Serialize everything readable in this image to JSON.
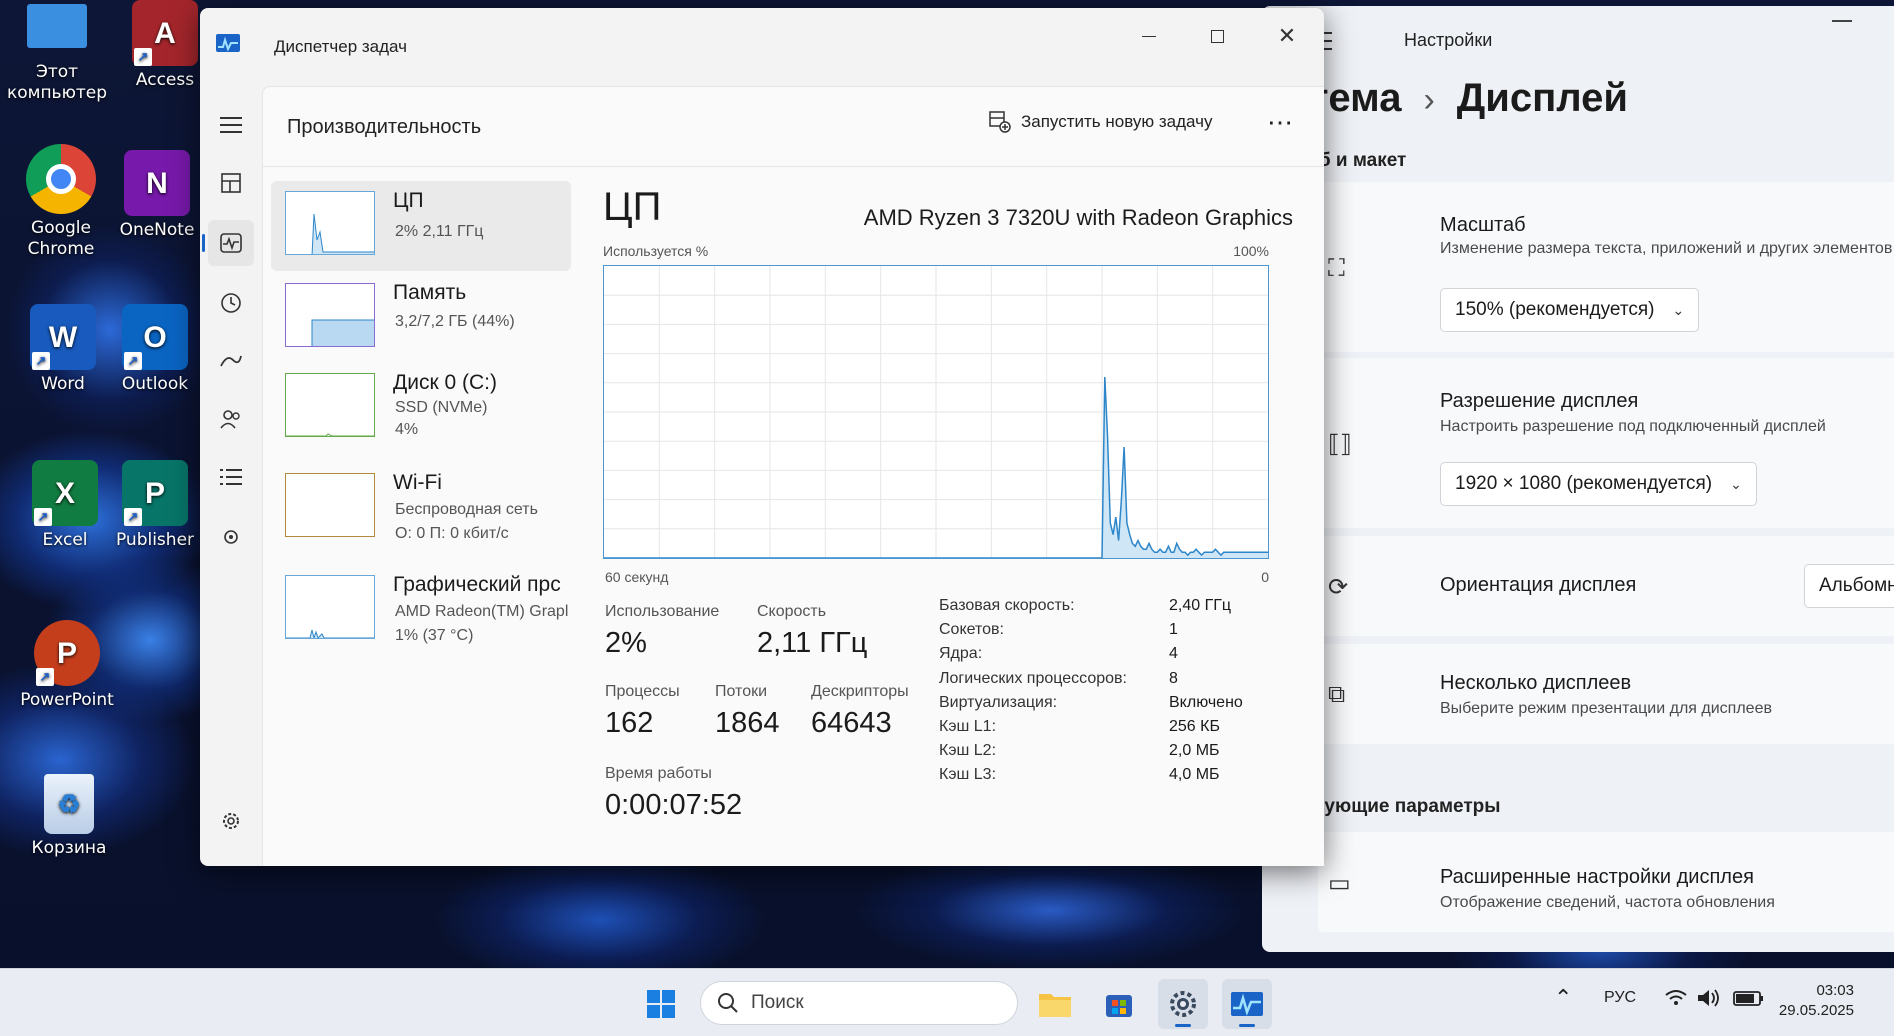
{
  "desktop": {
    "icons": [
      {
        "label_line1": "Этот",
        "label_line2": "компьютер",
        "name": "this-pc"
      },
      {
        "label_line1": "Access",
        "label_line2": "",
        "name": "access"
      },
      {
        "label_line1": "Google",
        "label_line2": "Chrome",
        "name": "chrome"
      },
      {
        "label_line1": "OneNote",
        "label_line2": "",
        "name": "onenote"
      },
      {
        "label_line1": "Word",
        "label_line2": "",
        "name": "word"
      },
      {
        "label_line1": "Outlook",
        "label_line2": "",
        "name": "outlook"
      },
      {
        "label_line1": "Excel",
        "label_line2": "",
        "name": "excel"
      },
      {
        "label_line1": "Publisher",
        "label_line2": "",
        "name": "publisher"
      },
      {
        "label_line1": "PowerPoint",
        "label_line2": "",
        "name": "powerpoint"
      },
      {
        "label_line1": "Корзина",
        "label_line2": "",
        "name": "recycle-bin"
      }
    ],
    "icon_letters": {
      "access": "A",
      "onenote": "N",
      "word": "W",
      "outlook": "O",
      "excel": "X",
      "publisher": "P",
      "powerpoint": "P"
    }
  },
  "task_manager": {
    "title": "Диспетчер задач",
    "page_title": "Производительность",
    "new_task_label": "Запустить новую задачу",
    "more_label": "⋯",
    "nav_icons": [
      "hamburger-icon",
      "processes-icon",
      "performance-icon",
      "app-history-icon",
      "startup-icon",
      "users-icon",
      "details-icon",
      "services-icon",
      "settings-icon"
    ],
    "perf_items": [
      {
        "name": "ЦП",
        "sub1": "2% 2,11 ГГц",
        "sub2": "",
        "sub3": ""
      },
      {
        "name": "Память",
        "sub1": "3,2/7,2 ГБ (44%)",
        "sub2": "",
        "sub3": ""
      },
      {
        "name": "Диск 0 (C:)",
        "sub1": "SSD (NVMe)",
        "sub2": "4%",
        "sub3": ""
      },
      {
        "name": "Wi-Fi",
        "sub1": "Беспроводная сеть",
        "sub2": "О: 0 П: 0 кбит/с",
        "sub3": ""
      },
      {
        "name": "Графический прс",
        "sub1": "AMD Radeon(TM) Grapl",
        "sub2": "1% (37 °C)",
        "sub3": ""
      }
    ],
    "cpu": {
      "heading": "ЦП",
      "model": "AMD Ryzen 3 7320U with Radeon Graphics",
      "graph_label_top_left": "Используется %",
      "graph_label_top_right": "100%",
      "graph_label_bottom_left": "60 секунд",
      "graph_label_bottom_right": "0",
      "usage_label": "Использование",
      "usage_value": "2%",
      "speed_label": "Скорость",
      "speed_value": "2,11 ГГц",
      "processes_label": "Процессы",
      "processes_value": "162",
      "threads_label": "Потоки",
      "threads_value": "1864",
      "handles_label": "Дескрипторы",
      "handles_value": "64643",
      "uptime_label": "Время работы",
      "uptime_value": "0:00:07:52",
      "specs": [
        {
          "k": "Базовая скорость:",
          "v": "2,40 ГГц"
        },
        {
          "k": "Сокетов:",
          "v": "1"
        },
        {
          "k": "Ядра:",
          "v": "4"
        },
        {
          "k": "Логических процессоров:",
          "v": "8"
        },
        {
          "k": "Виртуализация:",
          "v": "Включено"
        },
        {
          "k": "Кэш L1:",
          "v": "256 КБ"
        },
        {
          "k": "Кэш L2:",
          "v": "2,0 МБ"
        },
        {
          "k": "Кэш L3:",
          "v": "4,0 МБ"
        }
      ]
    },
    "cpu_history_percent": [
      0,
      0,
      0,
      0,
      0,
      0,
      0,
      0,
      0,
      0,
      0,
      0,
      0,
      0,
      0,
      0,
      0,
      0,
      0,
      0,
      0,
      0,
      0,
      0,
      0,
      0,
      0,
      0,
      0,
      0,
      0,
      0,
      0,
      0,
      0,
      0,
      0,
      0,
      0,
      0,
      0,
      0,
      0,
      0,
      0,
      0,
      0,
      0,
      0,
      0,
      0,
      0,
      0,
      0,
      0,
      0,
      0,
      0,
      0,
      0,
      0,
      0,
      0,
      0,
      0,
      0,
      0,
      0,
      0,
      0,
      0,
      0,
      0,
      0,
      0,
      0,
      0,
      0,
      0,
      0,
      0,
      0,
      0,
      0,
      0,
      0,
      0,
      0,
      0,
      0,
      0,
      0,
      0,
      0,
      0,
      0,
      0,
      0,
      0,
      0,
      0,
      0,
      0,
      0,
      0,
      0,
      0,
      0,
      0,
      0,
      0,
      0,
      0,
      0,
      0,
      0,
      0,
      0,
      0,
      0,
      0,
      0,
      0,
      0,
      0,
      0,
      0,
      0,
      0,
      0,
      0,
      0,
      0,
      0,
      0,
      0,
      0,
      0,
      0,
      0,
      0,
      0,
      0,
      0,
      0,
      0,
      0,
      0,
      0,
      0,
      0,
      0,
      0,
      0,
      0,
      0,
      0,
      0,
      0,
      0,
      0,
      0,
      0,
      0,
      0,
      0,
      0,
      0,
      0,
      0,
      0,
      0,
      0,
      0,
      0,
      0,
      0,
      0,
      0,
      0,
      0,
      62,
      42,
      12,
      8,
      14,
      6,
      20,
      38,
      12,
      8,
      5,
      4,
      6,
      4,
      3,
      3,
      5,
      3,
      2,
      2,
      3,
      2,
      2,
      4,
      2,
      2,
      5,
      3,
      2,
      2,
      1,
      2,
      2,
      3,
      2,
      1,
      2,
      2,
      2,
      2,
      3,
      2,
      1,
      2,
      2,
      2,
      2,
      2,
      2,
      2,
      2,
      2,
      2,
      2,
      2,
      2,
      2,
      2,
      2,
      2
    ]
  },
  "settings": {
    "title": "Настройки",
    "crumb_parent": "истема",
    "crumb_separator": "›",
    "crumb_current": "Дисплей",
    "section_scale": "асштаб и макет",
    "scale_name": "Масштаб",
    "scale_desc": "Изменение размера текста, приложений и других элементов",
    "scale_value": "150% (рекомендуется)",
    "resolution_name": "Разрешение дисплея",
    "resolution_desc": "Настроить разрешение под подключенный дисплей",
    "resolution_value": "1920 × 1080 (рекомендуется)",
    "orientation_name": "Ориентация дисплея",
    "orientation_value": "Альбомная",
    "multi_name": "Несколько дисплеев",
    "multi_desc": "Выберите режим презентации для дисплеев",
    "section_related": "путствующие параметры",
    "advanced_name": "Расширенные настройки дисплея",
    "advanced_desc": "Отображение сведений, частота обновления"
  },
  "taskbar": {
    "search_placeholder": "Поиск",
    "tray_up": "⌃",
    "language": "РУС",
    "time": "03:03",
    "date": "29.05.2025"
  }
}
